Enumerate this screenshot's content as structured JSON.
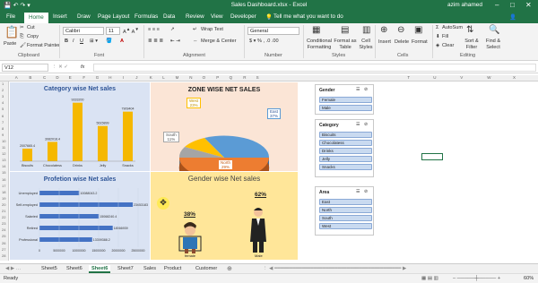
{
  "window": {
    "title": "Sales Dashboard.xlsx  -  Excel",
    "user": "azim ahamed"
  },
  "ribbon_tabs": [
    {
      "label": "File"
    },
    {
      "label": "Home"
    },
    {
      "label": "Insert"
    },
    {
      "label": "Draw"
    },
    {
      "label": "Page Layout"
    },
    {
      "label": "Formulas"
    },
    {
      "label": "Data"
    },
    {
      "label": "Review"
    },
    {
      "label": "View"
    },
    {
      "label": "Developer"
    }
  ],
  "tell_me": "Tell me what you want to do",
  "ribbon": {
    "paste": "Paste",
    "cut": "Cut",
    "copy": "Copy",
    "format_painter": "Format Painter",
    "font_name": "Calibri",
    "font_size": "11",
    "wrap_text": "Wrap Text",
    "merge_center": "Merge & Center",
    "number_format": "General",
    "conditional_formatting": "Conditional Formatting",
    "format_as_table": "Format as Table",
    "cell_styles": "Cell Styles",
    "insert": "Insert",
    "delete": "Delete",
    "format": "Format",
    "autosum": "AutoSum",
    "fill": "Fill",
    "clear": "Clear",
    "sort_filter": "Sort & Filter",
    "find_select": "Find & Select",
    "groups": {
      "clipboard": "Clipboard",
      "font": "Font",
      "alignment": "Alignment",
      "number": "Number",
      "styles": "Styles",
      "cells": "Cells",
      "editing": "Editing"
    }
  },
  "name_box": "V12",
  "fx": "fx",
  "columns": [
    "A",
    "B",
    "C",
    "D",
    "E",
    "F",
    "G",
    "H",
    "I",
    "J",
    "K",
    "L",
    "M",
    "N",
    "O",
    "P",
    "Q",
    "R",
    "S",
    "T",
    "U",
    "V",
    "W",
    "X",
    "Y"
  ],
  "rows": [
    "1",
    "2",
    "3",
    "4",
    "5",
    "6",
    "7",
    "8",
    "9",
    "10",
    "11",
    "12",
    "13",
    "14",
    "15",
    "16",
    "17",
    "18",
    "19",
    "20",
    "21",
    "22",
    "23",
    "24",
    "25",
    "26",
    "27",
    "28"
  ],
  "charts": {
    "category": {
      "title": "Category wise Net sales",
      "categories": [
        "Biscuits",
        "Chocolatess",
        "Drinks",
        "Jelly",
        "Snacks"
      ],
      "values": [
        2007665.4,
        3082018.4,
        9333200,
        5615899,
        7909404
      ],
      "labels": [
        "2007665.4",
        "3082018.4",
        "9333200",
        "5615899",
        "7909404"
      ],
      "color": "#f5b800"
    },
    "zone": {
      "title": "ZONE WISE NET SALES",
      "slices": [
        {
          "name": "East",
          "pct": "37%",
          "value": 37,
          "color": "#5b9bd5"
        },
        {
          "name": "North",
          "pct": "29%",
          "value": 29,
          "color": "#ed7d31"
        },
        {
          "name": "South",
          "pct": "11%",
          "value": 11,
          "color": "#a5a5a5"
        },
        {
          "name": "West",
          "pct": "23%",
          "value": 23,
          "color": "#ffc000"
        }
      ]
    },
    "profession": {
      "title": "Profetion wise Net sales",
      "categories": [
        "Unemployed",
        "Self-employed",
        "Salaried",
        "Retired",
        "Professional"
      ],
      "values": [
        10088043.2,
        23653183,
        15068240.4,
        18566939,
        13359388.2
      ],
      "labels": [
        "10088043.2",
        "23653183",
        "15068240.4",
        "18566939",
        "13359388.2"
      ],
      "ticks": [
        "0",
        "5000000",
        "10000000",
        "15000000",
        "20000000",
        "25000000"
      ],
      "color": "#4472c4"
    },
    "gender": {
      "title": "Gender wise Net sales",
      "female_label": "female",
      "male_label": "Male",
      "female_pct": "38%",
      "male_pct": "62%"
    }
  },
  "slicers": {
    "gender": {
      "title": "Gender",
      "items": [
        "Female",
        "Male"
      ]
    },
    "category": {
      "title": "Category",
      "items": [
        "Biscuits",
        "Chocolatess",
        "Drinks",
        "Jelly",
        "Snacks"
      ]
    },
    "area": {
      "title": "Area",
      "items": [
        "East",
        "North",
        "South",
        "West"
      ]
    }
  },
  "sheet_tabs": [
    "Sheet5",
    "Sheet6",
    "Sheet6",
    "Sheet7",
    "Sales",
    "Product",
    "Customer"
  ],
  "active_sheet_index": 2,
  "status": {
    "ready": "Ready",
    "zoom": "60%"
  }
}
